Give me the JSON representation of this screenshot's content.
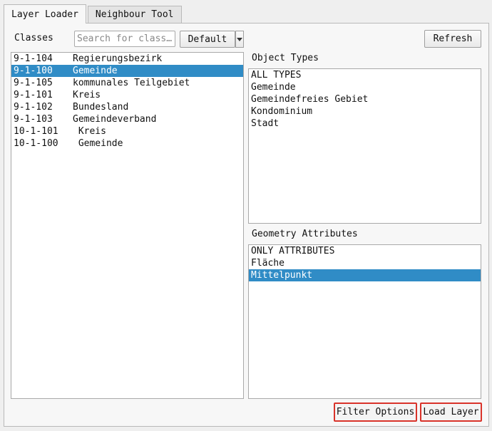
{
  "tabs": [
    {
      "label": "Layer Loader",
      "active": true
    },
    {
      "label": "Neighbour Tool",
      "active": false
    }
  ],
  "classes": {
    "label": "Classes",
    "search_placeholder": "Search for class…",
    "default_label": "Default",
    "items": [
      {
        "code": "9-1-104",
        "name": "Regierungsbezirk",
        "selected": false
      },
      {
        "code": "9-1-100",
        "name": "Gemeinde",
        "selected": true
      },
      {
        "code": "9-1-105",
        "name": "kommunales Teilgebiet",
        "selected": false
      },
      {
        "code": "9-1-101",
        "name": "Kreis",
        "selected": false
      },
      {
        "code": "9-1-102",
        "name": "Bundesland",
        "selected": false
      },
      {
        "code": "9-1-103",
        "name": "Gemeindeverband",
        "selected": false
      },
      {
        "code": "10-1-101",
        "name": " Kreis",
        "selected": false
      },
      {
        "code": "10-1-100",
        "name": " Gemeinde",
        "selected": false
      }
    ]
  },
  "refresh_label": "Refresh",
  "object_types": {
    "label": "Object Types",
    "items": [
      "ALL TYPES",
      "Gemeinde",
      "Gemeindefreies Gebiet",
      "Kondominium",
      "Stadt"
    ]
  },
  "geometry_attributes": {
    "label": "Geometry Attributes",
    "items": [
      {
        "name": "ONLY ATTRIBUTES",
        "selected": false
      },
      {
        "name": "Fläche",
        "selected": false
      },
      {
        "name": "Mittelpunkt",
        "selected": true
      }
    ]
  },
  "actions": {
    "filter_options_label": "Filter Options",
    "load_layer_label": "Load Layer"
  },
  "colors": {
    "selection": "#308cc6",
    "highlight_border": "#d9332a"
  }
}
